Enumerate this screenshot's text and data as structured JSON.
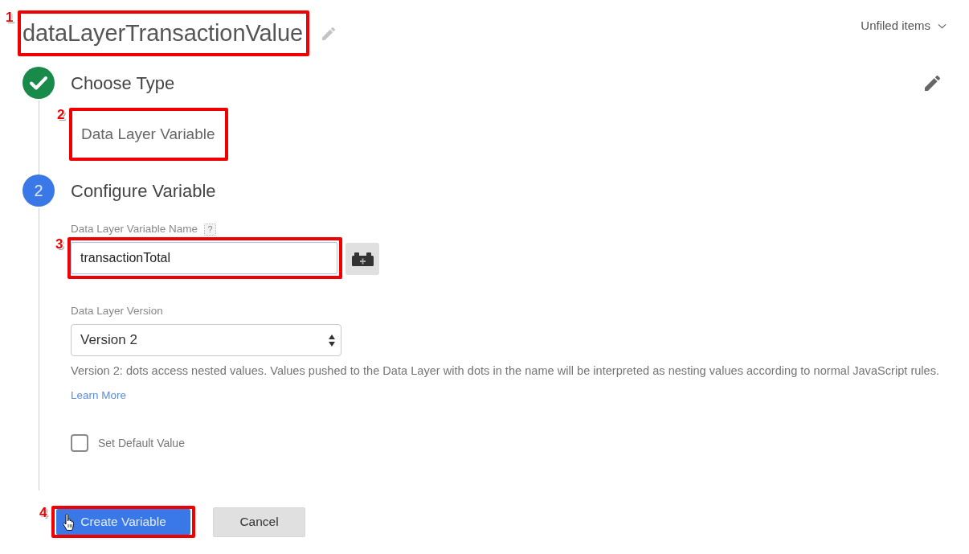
{
  "header": {
    "title": {
      "text": "dataLayerTransactionValue",
      "callout": "1"
    },
    "folder_menu": "Unfiled items"
  },
  "steps": [
    {
      "kind": "done",
      "title": "Choose Type",
      "summary": {
        "text": "Data Layer Variable",
        "callout": "2"
      }
    },
    {
      "kind": "active",
      "number": "2",
      "title": "Configure Variable",
      "fields": [
        {
          "kind": "text",
          "label": "Data Layer Variable Name",
          "help": "?",
          "value": "transactionTotal",
          "callout": "3"
        },
        {
          "kind": "select",
          "label": "Data Layer Version",
          "value": "Version 2",
          "description": "Version 2: dots access nested values. Values pushed to the Data Layer with dots in the name will be interpreted as nesting values according to normal JavaScript rules.",
          "link": "Learn More"
        },
        {
          "kind": "checkbox",
          "label": "Set Default Value",
          "checked": false
        }
      ]
    }
  ],
  "buttons": [
    {
      "kind": "primary",
      "label": "Create Variable",
      "callout": "4"
    },
    {
      "kind": "secondary",
      "label": "Cancel"
    }
  ]
}
